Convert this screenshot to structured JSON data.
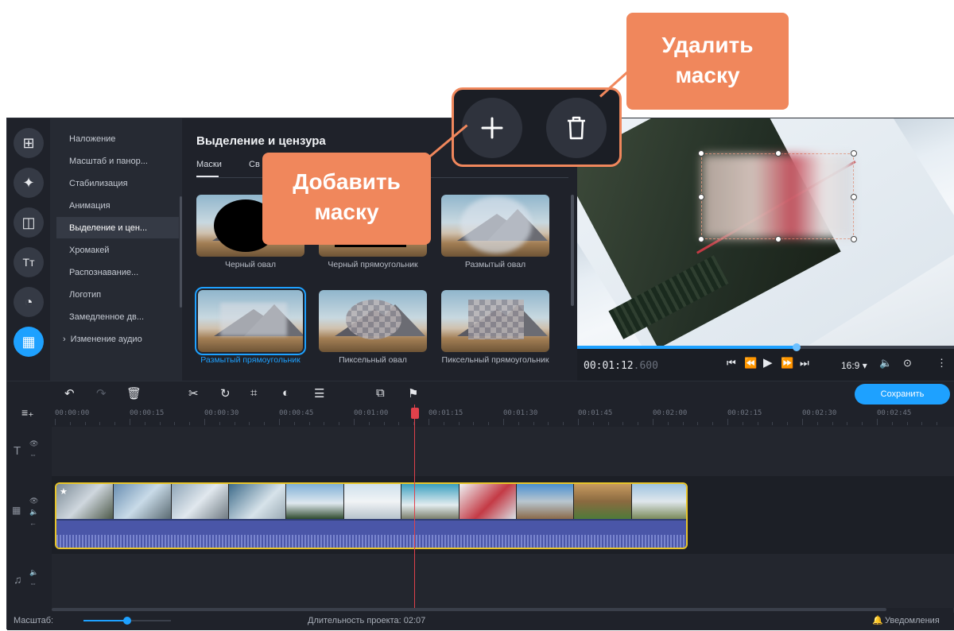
{
  "tools": {
    "items": [
      {
        "label": "Наложение"
      },
      {
        "label": "Масштаб и панор..."
      },
      {
        "label": "Стабилизация"
      },
      {
        "label": "Анимация"
      },
      {
        "label": "Выделение и цен..."
      },
      {
        "label": "Хромакей"
      },
      {
        "label": "Распознавание..."
      },
      {
        "label": "Логотип"
      },
      {
        "label": "Замедленное дв..."
      },
      {
        "label": "Изменение аудио"
      }
    ]
  },
  "panel": {
    "title": "Выделение и цензура",
    "tabs": [
      {
        "label": "Маски"
      },
      {
        "label": "Св"
      }
    ],
    "masks": [
      {
        "label": "Черный овал"
      },
      {
        "label": "Черный прямоугольник"
      },
      {
        "label": "Размытый овал"
      },
      {
        "label": "Размытый прямоугольник"
      },
      {
        "label": "Пиксельный овал"
      },
      {
        "label": "Пиксельный прямоугольник"
      }
    ]
  },
  "player": {
    "timecode": "00:01:12",
    "timecode_ms": ".600",
    "aspect": "16:9 ▾",
    "progress": 0.58
  },
  "toolbar": {
    "save_label": "Сохранить"
  },
  "ruler": {
    "ticks": [
      "00:00:00",
      "00:00:15",
      "00:00:30",
      "00:00:45",
      "00:01:00",
      "00:01:15",
      "00:01:30",
      "00:01:45",
      "00:02:00",
      "00:02:15",
      "00:02:30",
      "00:02:45"
    ]
  },
  "status": {
    "zoom_label": "Масштаб:",
    "duration": "Длительность проекта: 02:07",
    "notifications": "Уведомления"
  },
  "callouts": {
    "delete_mask": "Удалить маску",
    "add_mask": "Добавить маску"
  },
  "colors": {
    "accent": "#1ea1ff",
    "callout": "#f0875c",
    "clip_border": "#e8c52a",
    "playhead": "#e0414b"
  }
}
